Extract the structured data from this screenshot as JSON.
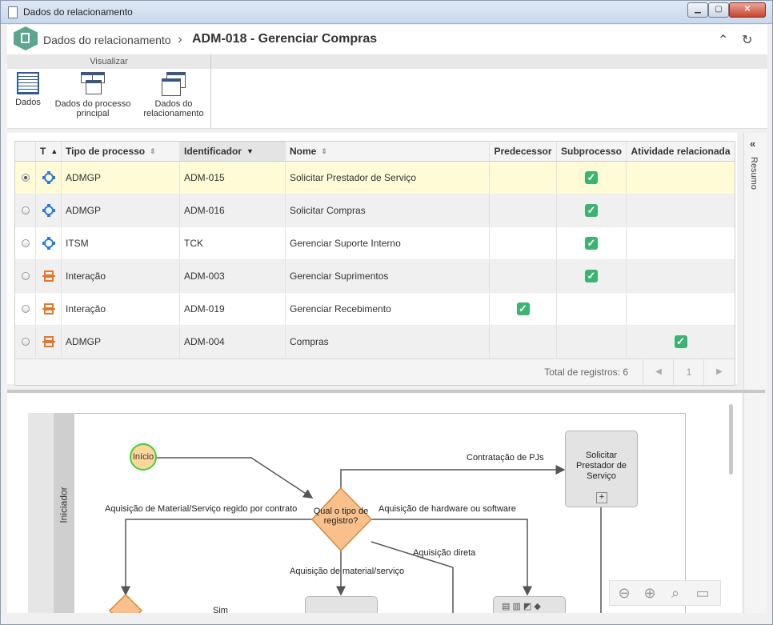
{
  "window": {
    "title": "Dados do relacionamento"
  },
  "header": {
    "breadcrumb_parent": "Dados do relacionamento",
    "breadcrumb_current": "ADM-018 - Gerenciar Compras"
  },
  "ribbon": {
    "group_label": "Visualizar",
    "buttons": [
      {
        "label_l1": "Dados",
        "label_l2": ""
      },
      {
        "label_l1": "Dados do processo",
        "label_l2": "principal"
      },
      {
        "label_l1": "Dados do",
        "label_l2": "relacionamento"
      }
    ]
  },
  "grid": {
    "columns": [
      "T",
      "Tipo de processo",
      "Identificador",
      "Nome",
      "Predecessor",
      "Subprocesso",
      "Atividade relacionada"
    ],
    "rows": [
      {
        "tipo": "ADMGP",
        "id": "ADM-015",
        "nome": "Solicitar Prestador de Serviço",
        "icon": "process-blue-icon",
        "selected": true,
        "pred": false,
        "sub": true,
        "ativ": false
      },
      {
        "tipo": "ADMGP",
        "id": "ADM-016",
        "nome": "Solicitar Compras",
        "icon": "process-blue-icon",
        "selected": false,
        "pred": false,
        "sub": true,
        "ativ": false
      },
      {
        "tipo": "ITSM",
        "id": "TCK",
        "nome": "Gerenciar Suporte Interno",
        "icon": "process-blue-icon",
        "selected": false,
        "pred": false,
        "sub": true,
        "ativ": false
      },
      {
        "tipo": "Interação",
        "id": "ADM-003",
        "nome": "Gerenciar Suprimentos",
        "icon": "process-orange-icon",
        "selected": false,
        "pred": false,
        "sub": true,
        "ativ": false
      },
      {
        "tipo": "Interação",
        "id": "ADM-019",
        "nome": "Gerenciar Recebimento",
        "icon": "process-orange-icon",
        "selected": false,
        "pred": true,
        "sub": false,
        "ativ": false
      },
      {
        "tipo": "ADMGP",
        "id": "ADM-004",
        "nome": "Compras",
        "icon": "process-orange-icon",
        "selected": false,
        "pred": false,
        "sub": false,
        "ativ": true
      }
    ],
    "footer": {
      "total_label": "Total de registros: 6",
      "page": "1"
    }
  },
  "side_panel": {
    "label": "Resumo"
  },
  "diagram": {
    "lane_label": "Iniciador",
    "start_label": "Início",
    "gateway_label_l1": "Qual o tipo de",
    "gateway_label_l2": "registro?",
    "task1_l1": "Solicitar",
    "task1_l2": "Prestador de",
    "task1_l3": "Serviço",
    "flow_pj": "Contratação de PJs",
    "flow_contrato": "Aquisição de Material/Serviço regido por contrato",
    "flow_hw": "Aquisição de hardware ou software",
    "flow_direta": "Aquisição direta",
    "flow_material": "Aquisição de material/serviço",
    "flow_sim": "Sim"
  },
  "colors": {
    "accent": "#5aa78e",
    "check": "#3cb371",
    "selected_row": "#fffbd6",
    "gateway": "#f9c08b"
  }
}
